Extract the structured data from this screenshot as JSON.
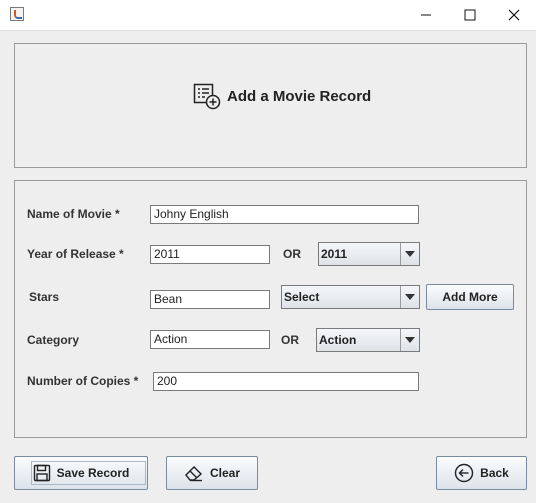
{
  "window": {
    "icon": "java-icon",
    "controls": [
      "minimize-icon",
      "maximize-icon",
      "close-icon"
    ]
  },
  "header": {
    "icon": "add-record-icon",
    "title": "Add a Movie Record"
  },
  "form": {
    "name": {
      "label": "Name of Movie *",
      "value": "Johny English"
    },
    "year": {
      "label": "Year of Release *",
      "value": "2011",
      "or_label": "OR",
      "select_value": "2011"
    },
    "stars": {
      "label": "Stars",
      "value": "Bean",
      "select_value": "Select",
      "add_more_label": "Add More"
    },
    "category": {
      "label": "Category",
      "value": "Action",
      "or_label": "OR",
      "select_value": "Action"
    },
    "copies": {
      "label": "Number of Copies *",
      "value": "200"
    }
  },
  "buttons": {
    "save": {
      "label": "Save Record",
      "icon": "save-icon"
    },
    "clear": {
      "label": "Clear",
      "icon": "eraser-icon"
    },
    "back": {
      "label": "Back",
      "icon": "back-arrow-icon"
    }
  }
}
